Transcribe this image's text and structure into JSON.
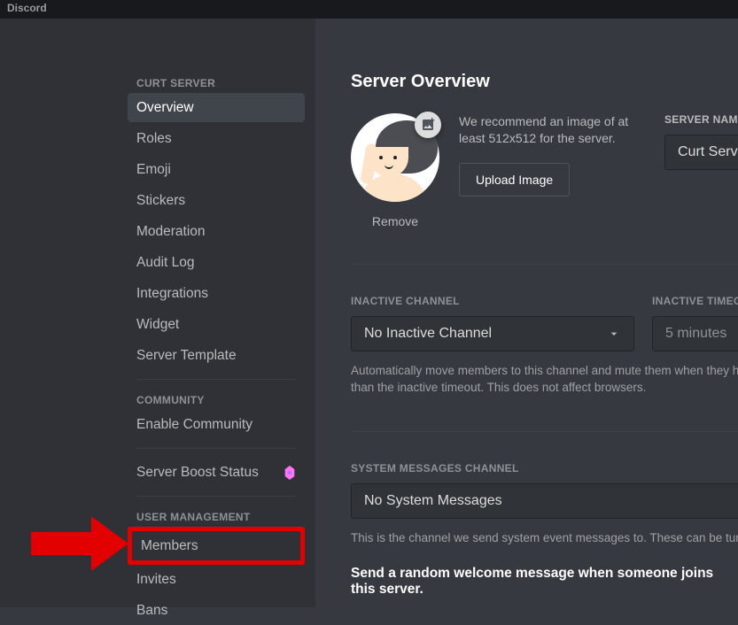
{
  "titlebar": "Discord",
  "sidebar": {
    "server_header": "CURT SERVER",
    "community_header": "COMMUNITY",
    "user_header": "USER MANAGEMENT",
    "items": {
      "overview": "Overview",
      "roles": "Roles",
      "emoji": "Emoji",
      "stickers": "Stickers",
      "moderation": "Moderation",
      "audit": "Audit Log",
      "integrations": "Integrations",
      "widget": "Widget",
      "template": "Server Template",
      "enable_community": "Enable Community",
      "boost": "Server Boost Status",
      "members": "Members",
      "invites": "Invites",
      "bans": "Bans"
    }
  },
  "main": {
    "title": "Server Overview",
    "recommend": "We recommend an image of at least 512x512 for the server.",
    "upload": "Upload Image",
    "remove": "Remove",
    "server_name_label": "SERVER NAME",
    "server_name_value": "Curt Server",
    "inactive_label": "INACTIVE CHANNEL",
    "inactive_value": "No Inactive Channel",
    "timeout_label": "INACTIVE TIMEOUT",
    "timeout_value": "5 minutes",
    "inactive_helper": "Automatically move members to this channel and mute them when they have been idle for longer than the inactive timeout. This does not affect browsers.",
    "sys_label": "SYSTEM MESSAGES CHANNEL",
    "sys_value": "No System Messages",
    "sys_helper": "This is the channel we send system event messages to. These can be turned off at any time.",
    "welcome_toggle": "Send a random welcome message when someone joins this server."
  }
}
